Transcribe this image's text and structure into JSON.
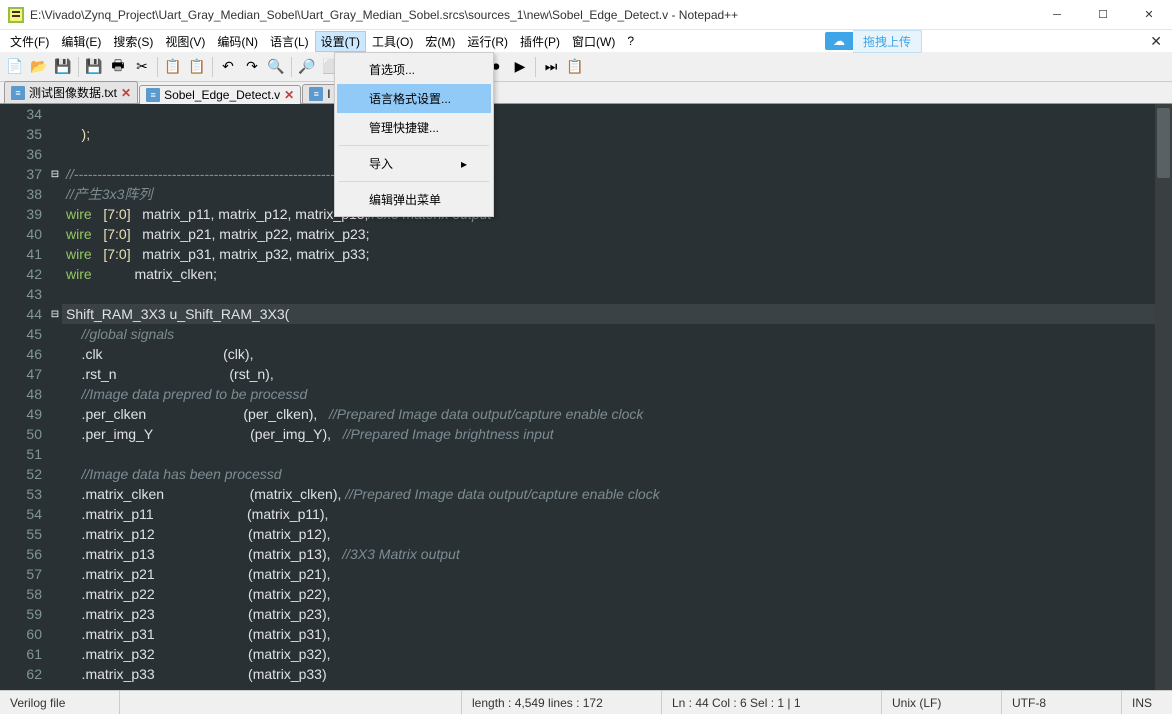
{
  "title": "E:\\Vivado\\Zynq_Project\\Uart_Gray_Median_Sobel\\Uart_Gray_Median_Sobel.srcs\\sources_1\\new\\Sobel_Edge_Detect.v - Notepad++",
  "menu": {
    "items": [
      "文件(F)",
      "编辑(E)",
      "搜索(S)",
      "视图(V)",
      "编码(N)",
      "语言(L)",
      "设置(T)",
      "工具(O)",
      "宏(M)",
      "运行(R)",
      "插件(P)",
      "窗口(W)",
      "?"
    ],
    "open_index": 6
  },
  "dropdown": {
    "items": [
      "首选项...",
      "语言格式设置...",
      "管理快捷键...",
      "导入",
      "编辑弹出菜单"
    ],
    "hl": 1,
    "sub_index": 3,
    "sep_before": [
      3,
      4
    ]
  },
  "cloud": {
    "left": "∞",
    "right": "拖拽上传"
  },
  "tabs": [
    {
      "label": "测试图像数据.txt",
      "active": false,
      "close": "✕"
    },
    {
      "label": "Sobel_Edge_Detect.v",
      "active": true,
      "close": "✕"
    },
    {
      "label": "I",
      "active": false,
      "close": ""
    }
  ],
  "code": {
    "start": 34,
    "lines": [
      {
        "n": 34,
        "seg": []
      },
      {
        "n": 35,
        "seg": [
          {
            "t": "    );",
            "c": "punct"
          }
        ]
      },
      {
        "n": 36,
        "seg": []
      },
      {
        "n": 37,
        "seg": [
          {
            "t": "//-------------------------------------------------------------------------",
            "c": "comment"
          }
        ],
        "fold": "⊟"
      },
      {
        "n": 38,
        "seg": [
          {
            "t": "//产生3x3阵列",
            "c": "comment"
          }
        ]
      },
      {
        "n": 39,
        "seg": [
          {
            "t": "wire",
            "c": "kw"
          },
          {
            "t": "   [7:0]   ",
            "c": "range"
          },
          {
            "t": "matrix_p11, matrix_p12, matrix_p13;",
            "c": "ident"
          },
          {
            "t": "//3x3 materix output",
            "c": "comment"
          }
        ]
      },
      {
        "n": 40,
        "seg": [
          {
            "t": "wire",
            "c": "kw"
          },
          {
            "t": "   [7:0]   ",
            "c": "range"
          },
          {
            "t": "matrix_p21, matrix_p22, matrix_p23;",
            "c": "ident"
          }
        ]
      },
      {
        "n": 41,
        "seg": [
          {
            "t": "wire",
            "c": "kw"
          },
          {
            "t": "   [7:0]   ",
            "c": "range"
          },
          {
            "t": "matrix_p31, matrix_p32, matrix_p33;",
            "c": "ident"
          }
        ]
      },
      {
        "n": 42,
        "seg": [
          {
            "t": "wire",
            "c": "kw"
          },
          {
            "t": "           matrix_clken;",
            "c": "ident"
          }
        ]
      },
      {
        "n": 43,
        "seg": []
      },
      {
        "n": 44,
        "seg": [
          {
            "t": "Shift_RAM_3X3 u_Shift_RAM_3X3(",
            "c": "ident"
          }
        ],
        "fold": "⊟",
        "cur": true
      },
      {
        "n": 45,
        "seg": [
          {
            "t": "    //global signals",
            "c": "comment"
          }
        ]
      },
      {
        "n": 46,
        "seg": [
          {
            "t": "    .clk                               (clk),",
            "c": "ident"
          }
        ]
      },
      {
        "n": 47,
        "seg": [
          {
            "t": "    .rst_n                             (rst_n),",
            "c": "ident"
          }
        ]
      },
      {
        "n": 48,
        "seg": [
          {
            "t": "    //Image data prepred to be processd",
            "c": "comment"
          }
        ]
      },
      {
        "n": 49,
        "seg": [
          {
            "t": "    .per_clken                         (per_clken),   ",
            "c": "ident"
          },
          {
            "t": "//Prepared Image data output/capture enable clock",
            "c": "comment"
          }
        ]
      },
      {
        "n": 50,
        "seg": [
          {
            "t": "    .per_img_Y                         (per_img_Y),   ",
            "c": "ident"
          },
          {
            "t": "//Prepared Image brightness input",
            "c": "comment"
          }
        ]
      },
      {
        "n": 51,
        "seg": []
      },
      {
        "n": 52,
        "seg": [
          {
            "t": "    //Image data has been processd",
            "c": "comment"
          }
        ]
      },
      {
        "n": 53,
        "seg": [
          {
            "t": "    .matrix_clken                      (matrix_clken), ",
            "c": "ident"
          },
          {
            "t": "//Prepared Image data output/capture enable clock",
            "c": "comment"
          }
        ]
      },
      {
        "n": 54,
        "seg": [
          {
            "t": "    .matrix_p11                        (matrix_p11),",
            "c": "ident"
          }
        ]
      },
      {
        "n": 55,
        "seg": [
          {
            "t": "    .matrix_p12                        (matrix_p12),",
            "c": "ident"
          }
        ]
      },
      {
        "n": 56,
        "seg": [
          {
            "t": "    .matrix_p13                        (matrix_p13),   ",
            "c": "ident"
          },
          {
            "t": "//3X3 Matrix output",
            "c": "comment"
          }
        ]
      },
      {
        "n": 57,
        "seg": [
          {
            "t": "    .matrix_p21                        (matrix_p21),",
            "c": "ident"
          }
        ]
      },
      {
        "n": 58,
        "seg": [
          {
            "t": "    .matrix_p22                        (matrix_p22),",
            "c": "ident"
          }
        ]
      },
      {
        "n": 59,
        "seg": [
          {
            "t": "    .matrix_p23                        (matrix_p23),",
            "c": "ident"
          }
        ]
      },
      {
        "n": 60,
        "seg": [
          {
            "t": "    .matrix_p31                        (matrix_p31),",
            "c": "ident"
          }
        ]
      },
      {
        "n": 61,
        "seg": [
          {
            "t": "    .matrix_p32                        (matrix_p32),",
            "c": "ident"
          }
        ]
      },
      {
        "n": 62,
        "seg": [
          {
            "t": "    .matrix_p33                        (matrix_p33)",
            "c": "ident"
          }
        ]
      }
    ]
  },
  "toolbar": {
    "icons": [
      "📄",
      "📂",
      "💾",
      "💾",
      "🖶",
      "✂",
      "📋",
      "📋",
      "↶",
      "↷",
      "🔍",
      "🔎",
      "⬜",
      "👁",
      "🎯",
      "⬛",
      "▶",
      "⏹",
      "⏺",
      "▶",
      "⏭",
      "📋"
    ]
  },
  "status": {
    "lang": "Verilog file",
    "length": "length : 4,549    lines : 172",
    "pos": "Ln : 44    Col : 6    Sel : 1 | 1",
    "eol": "Unix (LF)",
    "enc": "UTF-8",
    "ins": "INS"
  }
}
